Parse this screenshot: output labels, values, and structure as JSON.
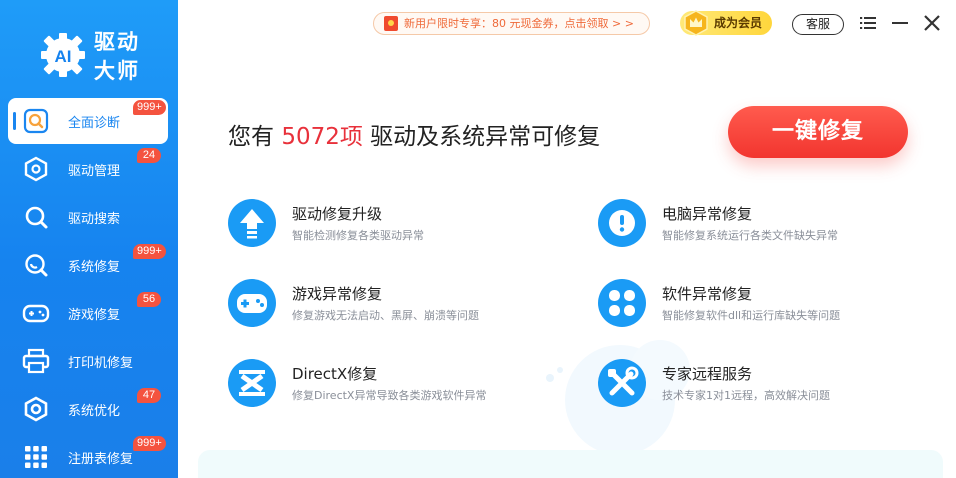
{
  "app": {
    "logo_line1": "驱动",
    "logo_line2": "大师",
    "logo_mark": "AI"
  },
  "sidebar": {
    "items": [
      {
        "label": "全面诊断",
        "badge": "999+",
        "active": true,
        "icon": "scan-icon"
      },
      {
        "label": "驱动管理",
        "badge": "24",
        "icon": "hexagon-icon"
      },
      {
        "label": "驱动搜索",
        "badge": "",
        "icon": "search-icon"
      },
      {
        "label": "系统修复",
        "badge": "999+",
        "icon": "wrench-icon"
      },
      {
        "label": "游戏修复",
        "badge": "56",
        "icon": "gamepad-icon"
      },
      {
        "label": "打印机修复",
        "badge": "",
        "icon": "printer-icon"
      },
      {
        "label": "系统优化",
        "badge": "47",
        "icon": "gear-icon"
      },
      {
        "label": "注册表修复",
        "badge": "999+",
        "icon": "grid-icon"
      }
    ]
  },
  "topbar": {
    "promo_text": "新用户限时专享：80 元现金券，点击领取 > >",
    "vip_label": "成为会员",
    "service_label": "客服"
  },
  "main": {
    "headline_prefix": "您有",
    "headline_count": "5072项",
    "headline_suffix": "驱动及系统异常可修复",
    "fix_button_label": "一键修复",
    "features": [
      {
        "title": "驱动修复升级",
        "desc": "智能检测修复各类驱动异常",
        "icon": "upgrade-arrow-icon"
      },
      {
        "title": "电脑异常修复",
        "desc": "智能修复系统运行各类文件缺失异常",
        "icon": "alert-icon"
      },
      {
        "title": "游戏异常修复",
        "desc": "修复游戏无法启动、黑屏、崩溃等问题",
        "icon": "gamepad-icon"
      },
      {
        "title": "软件异常修复",
        "desc": "智能修复软件dll和运行库缺失等问题",
        "icon": "apps-icon"
      },
      {
        "title": "DirectX修复",
        "desc": "修复DirectX异常导致各类游戏软件异常",
        "icon": "directx-icon"
      },
      {
        "title": "专家远程服务",
        "desc": "技术专家1对1远程，高效解决问题",
        "icon": "tools-icon"
      }
    ]
  },
  "colors": {
    "sidebar_blue": "#1683ef",
    "accent_red": "#e8313b",
    "button_red": "#f2352f",
    "icon_blue": "#1a9bf5"
  }
}
